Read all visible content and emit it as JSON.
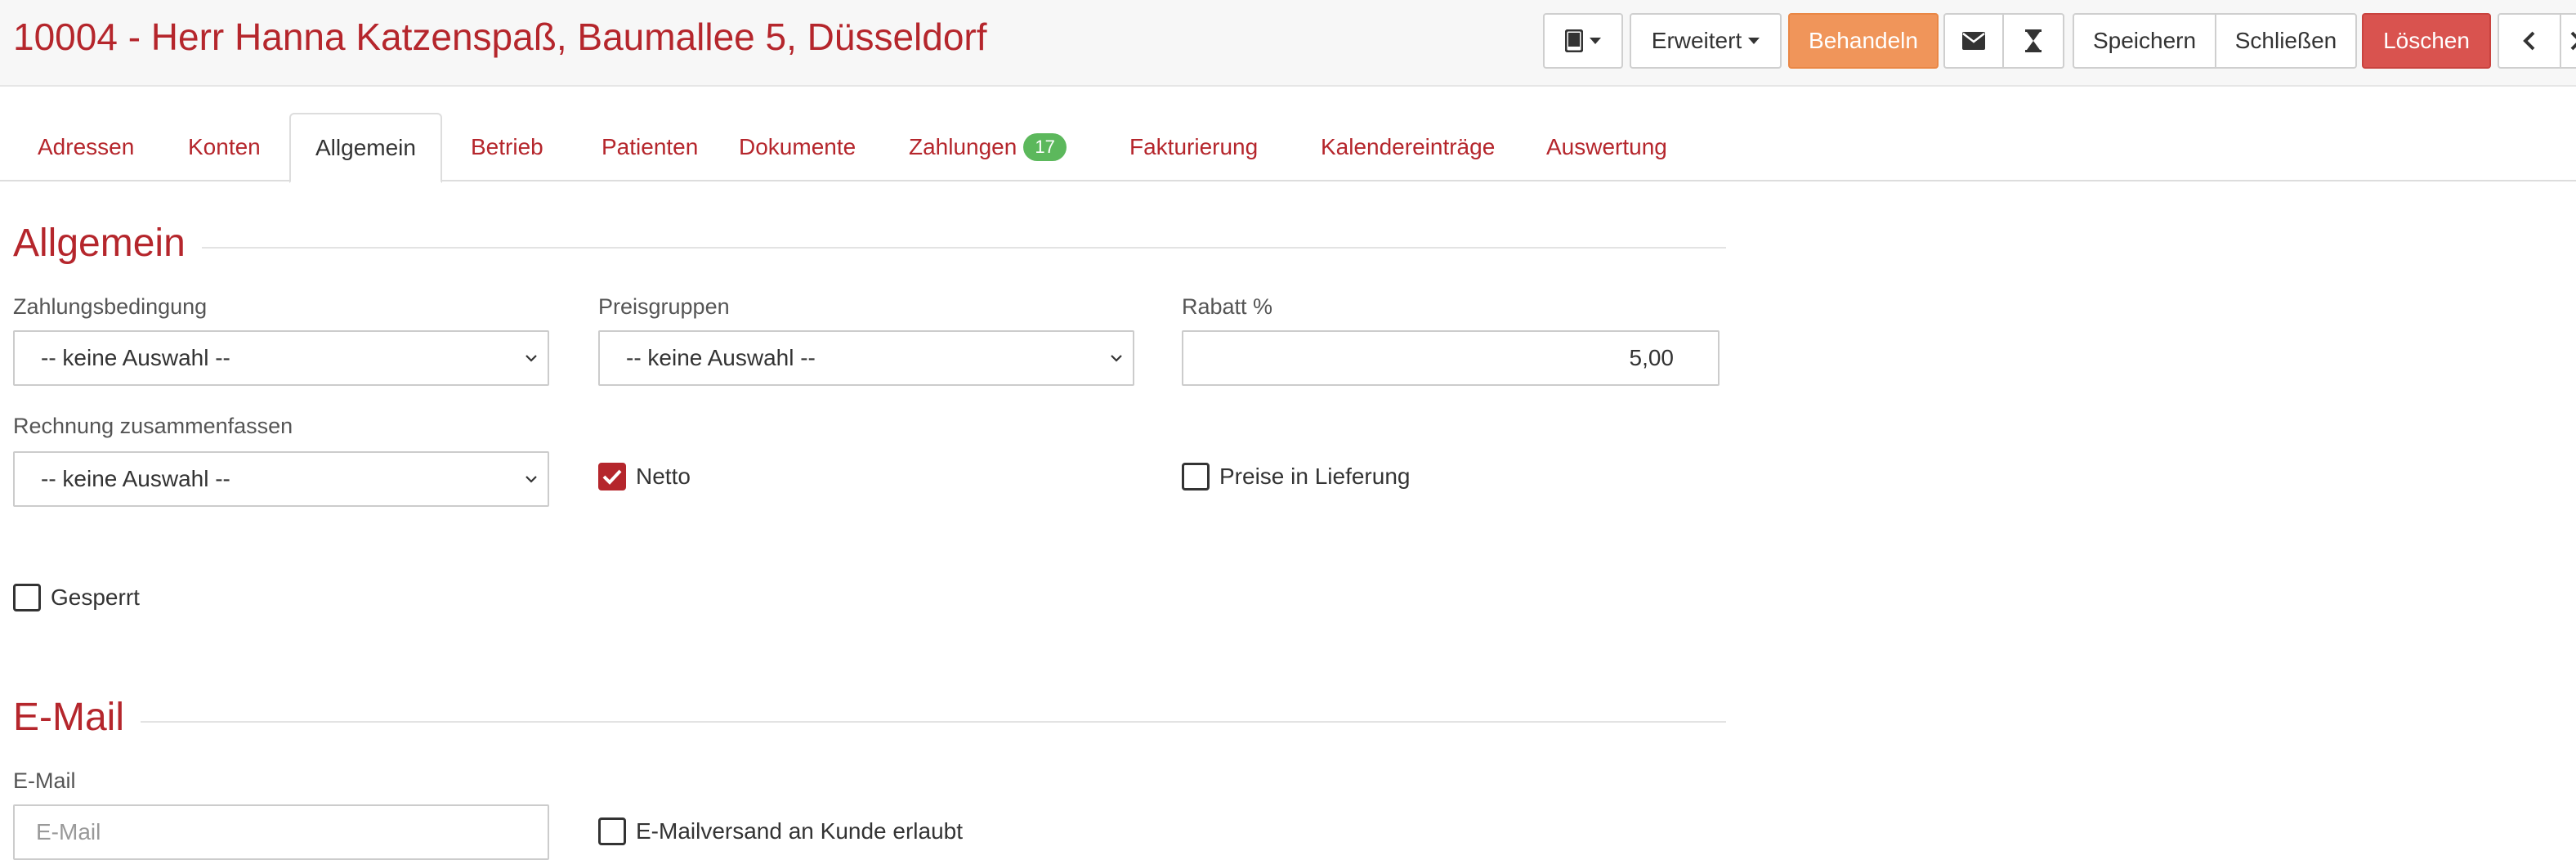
{
  "header": {
    "title": "10004 - Herr Hanna Katzenspaß, Baumallee 5, Düsseldorf",
    "buttons": {
      "device": "tablet-icon",
      "erweitert": "Erweitert",
      "behandeln": "Behandeln",
      "email_icon": "envelope-icon",
      "timer_icon": "hourglass-icon",
      "speichern": "Speichern",
      "schliessen": "Schließen",
      "loeschen": "Löschen",
      "prev_icon": "chevron-left-icon"
    },
    "colors": {
      "primary": "#b5262c",
      "behandeln": "#f0955a",
      "loeschen": "#d9534f",
      "badge": "#5cb85c"
    }
  },
  "tabs": [
    {
      "label": "Adressen"
    },
    {
      "label": "Konten"
    },
    {
      "label": "Allgemein",
      "active": true
    },
    {
      "label": "Betrieb"
    },
    {
      "label": "Patienten"
    },
    {
      "label": "Dokumente"
    },
    {
      "label": "Zahlungen",
      "badge": "17"
    },
    {
      "label": "Fakturierung"
    },
    {
      "label": "Kalendereinträge"
    },
    {
      "label": "Auswertung"
    }
  ],
  "allgemein": {
    "title": "Allgemein",
    "zahlungsbedingung": {
      "label": "Zahlungsbedingung",
      "value": "-- keine Auswahl --"
    },
    "preisgruppen": {
      "label": "Preisgruppen",
      "value": "-- keine Auswahl --"
    },
    "rabatt": {
      "label": "Rabatt %",
      "value": "5,00"
    },
    "rechnung": {
      "label": "Rechnung zusammenfassen",
      "value": "-- keine Auswahl --"
    },
    "netto": {
      "label": "Netto",
      "checked": true
    },
    "preise_lieferung": {
      "label": "Preise in Lieferung",
      "checked": false
    },
    "gesperrt": {
      "label": "Gesperrt",
      "checked": false
    }
  },
  "email": {
    "title": "E-Mail",
    "field": {
      "label": "E-Mail",
      "placeholder": "E-Mail",
      "value": ""
    },
    "versand": {
      "label": "E-Mailversand an Kunde erlaubt",
      "checked": false
    }
  }
}
